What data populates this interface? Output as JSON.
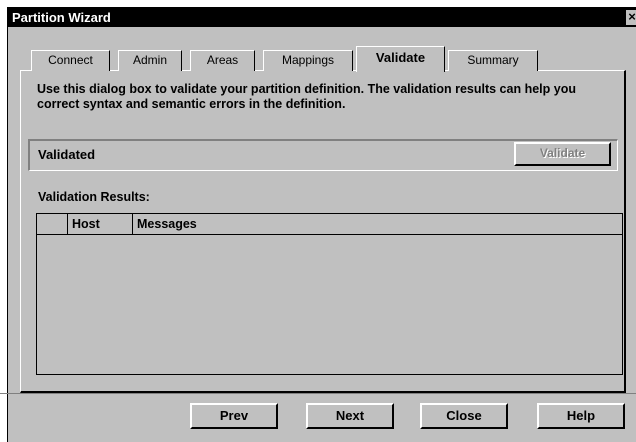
{
  "window": {
    "title": "Partition Wizard",
    "close_glyph": "×"
  },
  "tabs": [
    {
      "label": "Connect"
    },
    {
      "label": "Admin"
    },
    {
      "label": "Areas"
    },
    {
      "label": "Mappings"
    },
    {
      "label": "Validate",
      "active": true
    },
    {
      "label": "Summary"
    }
  ],
  "panel": {
    "description": "Use this dialog box to validate your partition definition.  The validation results can help you correct syntax and semantic errors in the definition.",
    "status": "Validated",
    "validate_button": "Validate",
    "results_label": "Validation Results:",
    "results_columns": [
      "",
      "Host",
      "Messages"
    ],
    "results_rows": []
  },
  "footer": {
    "prev": "Prev",
    "next": "Next",
    "close": "Close",
    "help": "Help"
  }
}
